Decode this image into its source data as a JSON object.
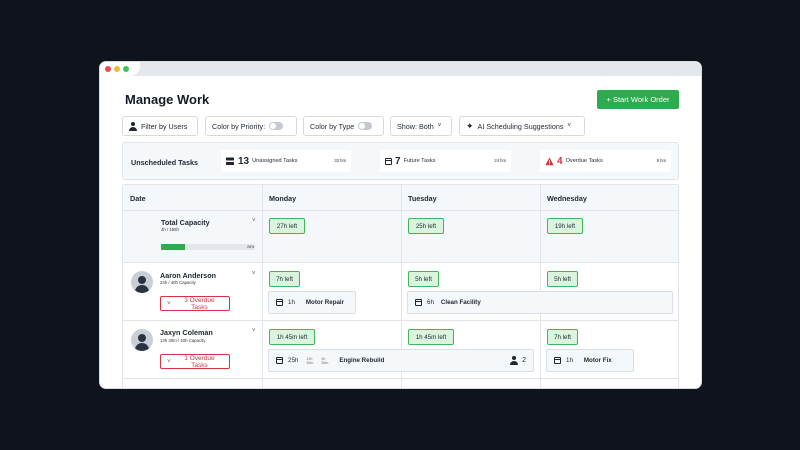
{
  "header": {
    "title": "Manage Work",
    "primary_action": "+ Start Work Order"
  },
  "toolbar": {
    "filter_users": "Filter by Users",
    "color_priority": "Color by Priority:",
    "color_type": "Color by Type",
    "show_label": "Show: Both",
    "ai_suggestions": "AI Scheduling Suggestions"
  },
  "unscheduled": {
    "label": "Unscheduled Tasks",
    "cards": [
      {
        "count": "13",
        "label": "Unassigned Tasks",
        "meta": "32 hrs"
      },
      {
        "count": "7",
        "label": "Future Tasks",
        "meta": "24 hrs"
      },
      {
        "count": "4",
        "label": "Overdue Tasks",
        "meta": "8 hrs"
      }
    ]
  },
  "columns": [
    "Date",
    "Monday",
    "Tuesday",
    "Wednesday"
  ],
  "capacity": {
    "name": "Total Capacity",
    "sub": "4h / 155h",
    "progress_pct": 26,
    "progress_label": "26%",
    "days": [
      "27h left",
      "25h left",
      "19h left"
    ]
  },
  "people": [
    {
      "name": "Aaron Anderson",
      "sub": "24h / 40h Capacity",
      "overdue": "3 Overdue Tasks",
      "days": [
        "7h left",
        "5h left",
        "5h left"
      ],
      "tasks": [
        {
          "hours": "1h",
          "name": "Motor Repair"
        },
        {
          "hours": "6h",
          "name": "Clean Facility"
        }
      ]
    },
    {
      "name": "Jaxyn Coleman",
      "sub": "13h 30m / 40h Capacity",
      "overdue": "1 Overdue Tasks",
      "days": [
        "1h 45m left",
        "1h 45m left",
        "7h left"
      ],
      "tasks": [
        {
          "hours": "25h",
          "split_a_top": "12h",
          "split_a_bottom": "30m",
          "split_b_top": "2h",
          "split_b_bottom": "30m",
          "name": "Engine Rebuild",
          "assignees": "2"
        },
        {
          "hours": "1h",
          "name": "Motor Fix"
        }
      ]
    }
  ],
  "icons": {
    "chevron": "˅",
    "sparkle": "✦"
  },
  "colors": {
    "accent": "#2eaa4f",
    "danger": "#d6333f",
    "chip_bg": "#d9f5dd",
    "panel": "#f5f8fa"
  }
}
